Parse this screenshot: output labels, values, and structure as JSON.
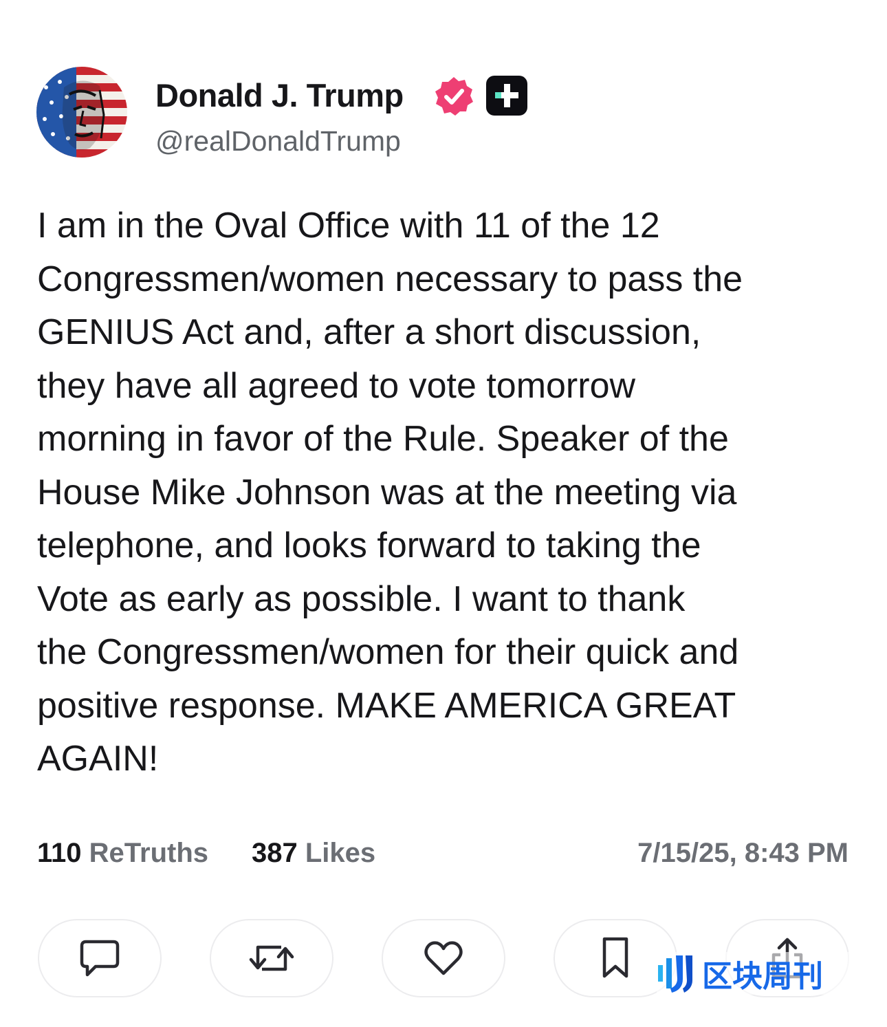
{
  "author": {
    "display_name": "Donald J. Trump",
    "handle": "@realDonaldTrump",
    "avatar_icon": "flag-portrait-avatar",
    "verified_icon": "verified-badge-icon",
    "verified_color": "#ee3f73",
    "plus_icon": "truth-plus-icon"
  },
  "post": {
    "lines": [
      "I am in the Oval Office with 11 of the 12",
      "Congressmen/women necessary to pass the",
      "GENIUS Act and, after a short discussion,",
      "they have all agreed to vote tomorrow",
      "morning in favor of the Rule. Speaker of the",
      "House Mike Johnson was at the meeting via",
      "telephone, and looks forward to taking the",
      "Vote as early as possible. I want to thank",
      "the Congressmen/women for their quick and",
      "positive response. MAKE AMERICA GREAT",
      "AGAIN!"
    ]
  },
  "stats": {
    "retruths_count": "110",
    "retruths_label": "ReTruths",
    "likes_count": "387",
    "likes_label": "Likes",
    "timestamp": "7/15/25, 8:43 PM"
  },
  "actions": [
    {
      "name": "reply",
      "icon": "comment-icon"
    },
    {
      "name": "retruth",
      "icon": "retruth-icon"
    },
    {
      "name": "like",
      "icon": "heart-icon"
    },
    {
      "name": "bookmark",
      "icon": "bookmark-icon"
    },
    {
      "name": "share",
      "icon": "share-icon"
    }
  ],
  "watermark": {
    "text": "区块周刊",
    "color": "#1769e8"
  }
}
